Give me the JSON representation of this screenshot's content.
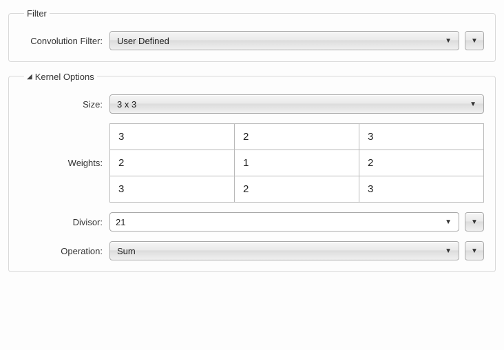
{
  "filter": {
    "legend": "Filter",
    "conv_label": "Convolution Filter:",
    "conv_value": "User Defined"
  },
  "kernel": {
    "legend": "Kernel Options",
    "size_label": "Size:",
    "size_value": "3 x 3",
    "weights_label": "Weights:",
    "weights": [
      [
        "3",
        "2",
        "3"
      ],
      [
        "2",
        "1",
        "2"
      ],
      [
        "3",
        "2",
        "3"
      ]
    ],
    "divisor_label": "Divisor:",
    "divisor_value": "21",
    "operation_label": "Operation:",
    "operation_value": "Sum"
  }
}
